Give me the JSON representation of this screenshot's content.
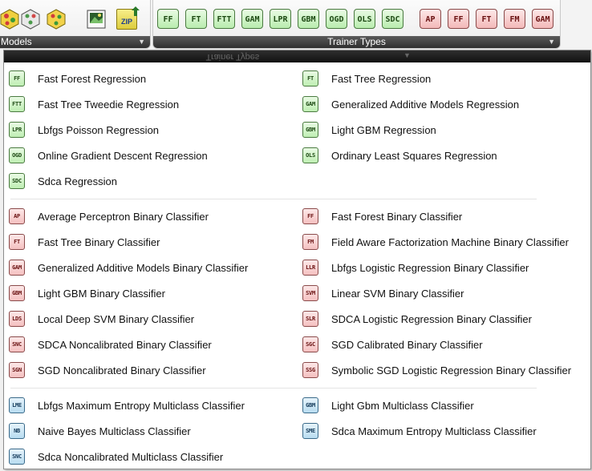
{
  "ribbon": {
    "models_group": {
      "title": "Models"
    },
    "trainer_group": {
      "title": "Trainer Types",
      "regression_buttons": [
        "FF",
        "FT",
        "FTT",
        "GAM",
        "LPR",
        "GBM",
        "OGD",
        "OLS",
        "SDC"
      ],
      "binary_buttons": [
        "AP",
        "FF",
        "FT",
        "FM",
        "GAM"
      ]
    },
    "zip_label": "ZIP"
  },
  "dropdown": {
    "header_mirror": "Trainer Types",
    "regression": [
      {
        "code": "FF",
        "label": "Fast Forest Regression"
      },
      {
        "code": "FT",
        "label": "Fast Tree Regression"
      },
      {
        "code": "FTT",
        "label": "Fast Tree Tweedie Regression"
      },
      {
        "code": "GAM",
        "label": "Generalized Additive Models Regression"
      },
      {
        "code": "LPR",
        "label": "Lbfgs Poisson Regression"
      },
      {
        "code": "GBM",
        "label": "Light GBM Regression"
      },
      {
        "code": "OGD",
        "label": "Online Gradient Descent Regression"
      },
      {
        "code": "OLS",
        "label": "Ordinary Least Squares Regression"
      },
      {
        "code": "SDC",
        "label": "Sdca Regression"
      }
    ],
    "binary": [
      {
        "code": "AP",
        "label": "Average Perceptron Binary Classifier"
      },
      {
        "code": "FF",
        "label": "Fast Forest Binary Classifier"
      },
      {
        "code": "FT",
        "label": "Fast Tree Binary Classifier"
      },
      {
        "code": "FM",
        "label": "Field Aware Factorization Machine Binary Classifier"
      },
      {
        "code": "GAM",
        "label": "Generalized Additive Models Binary Classifier"
      },
      {
        "code": "LLR",
        "label": "Lbfgs Logistic Regression Binary Classifier"
      },
      {
        "code": "GBM",
        "label": "Light GBM Binary Classifier"
      },
      {
        "code": "SVM",
        "label": "Linear SVM Binary Classifier"
      },
      {
        "code": "LDS",
        "label": "Local Deep SVM Binary Classifier"
      },
      {
        "code": "SLR",
        "label": "SDCA Logistic Regression Binary Classifier"
      },
      {
        "code": "SNC",
        "label": "SDCA Noncalibrated Binary Classifier"
      },
      {
        "code": "SGC",
        "label": "SGD Calibrated Binary Classifier"
      },
      {
        "code": "SGN",
        "label": "SGD Noncalibrated Binary Classifier"
      },
      {
        "code": "SSG",
        "label": "Symbolic SGD Logistic Regression Binary Classifier"
      }
    ],
    "multiclass": [
      {
        "code": "LME",
        "label": "Lbfgs Maximum Entropy Multiclass Classifier"
      },
      {
        "code": "GBM",
        "label": "Light Gbm Multiclass Classifier"
      },
      {
        "code": "NB",
        "label": "Naive Bayes Multiclass Classifier"
      },
      {
        "code": "SME",
        "label": "Sdca Maximum Entropy Multiclass Classifier"
      },
      {
        "code": "SNC",
        "label": "Sdca Noncalibrated Multiclass Classifier"
      }
    ]
  },
  "colors": {
    "regression": "#b9ecae",
    "binary": "#f3b9b9",
    "multiclass": "#b8dcf0",
    "header": "#1e1e1e"
  }
}
